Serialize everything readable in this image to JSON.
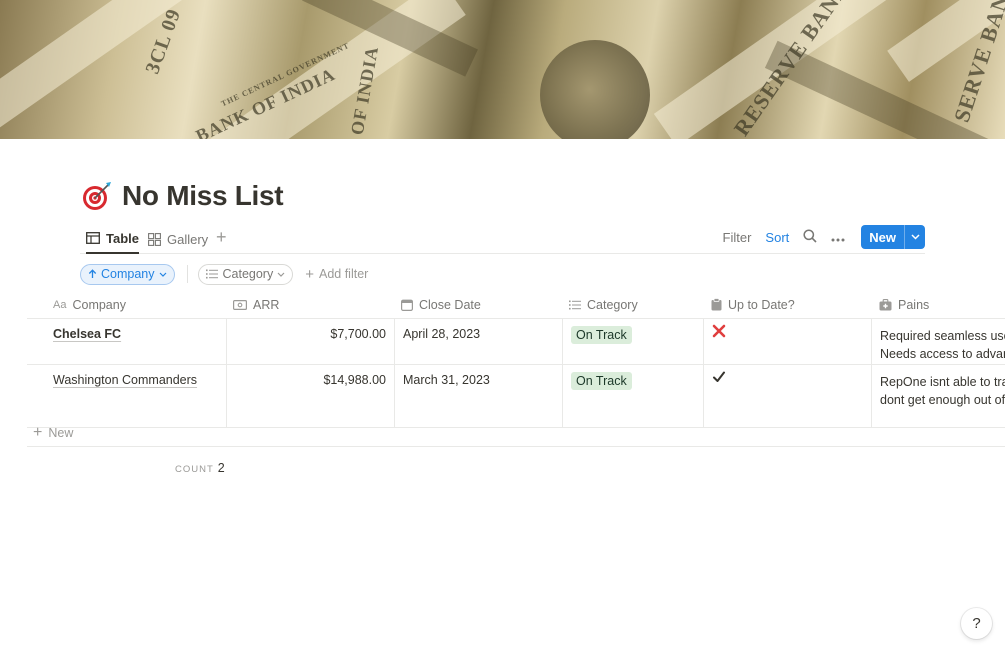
{
  "cover": {
    "texts": [
      "3CL 09",
      "OF INDIA",
      "BANK OF INDIA",
      "THE CENTRAL GOVERNMENT",
      "RESERVE BANK",
      "SERVE BAN"
    ]
  },
  "page": {
    "title": "No Miss List",
    "icon": "target-dart-icon"
  },
  "views": {
    "tabs": [
      {
        "label": "Table"
      },
      {
        "label": "Gallery"
      }
    ]
  },
  "toolbar": {
    "filter_label": "Filter",
    "sort_label": "Sort",
    "new_label": "New"
  },
  "filters": {
    "sort_pill": "Company",
    "category_pill": "Category",
    "add_filter": "Add filter"
  },
  "table": {
    "headers": [
      "Company",
      "ARR",
      "Close Date",
      "Category",
      "Up to Date?",
      "Pains"
    ],
    "rows": [
      {
        "company": "Chelsea FC",
        "arr": "$7,700.00",
        "close_date": "April 28, 2023",
        "category": "On Track",
        "up_to_date": "✕",
        "pains_1": "Required seamless user",
        "pains_2": "Needs access to advanc"
      },
      {
        "company": "Washington Commanders",
        "arr": "$14,988.00",
        "close_date": "March 31, 2023",
        "category": "On Track",
        "up_to_date": "✓",
        "pains_1": "RepOne isnt able to trac",
        "pains_2": "dont get enough out of"
      }
    ],
    "new_row_label": "New",
    "count_label": "COUNT",
    "count_value": "2"
  },
  "colors": {
    "accent": "#2383e2",
    "tag_green_bg": "#dbeddb",
    "cross_red": "#e03e3e"
  },
  "help": {
    "label": "?"
  }
}
